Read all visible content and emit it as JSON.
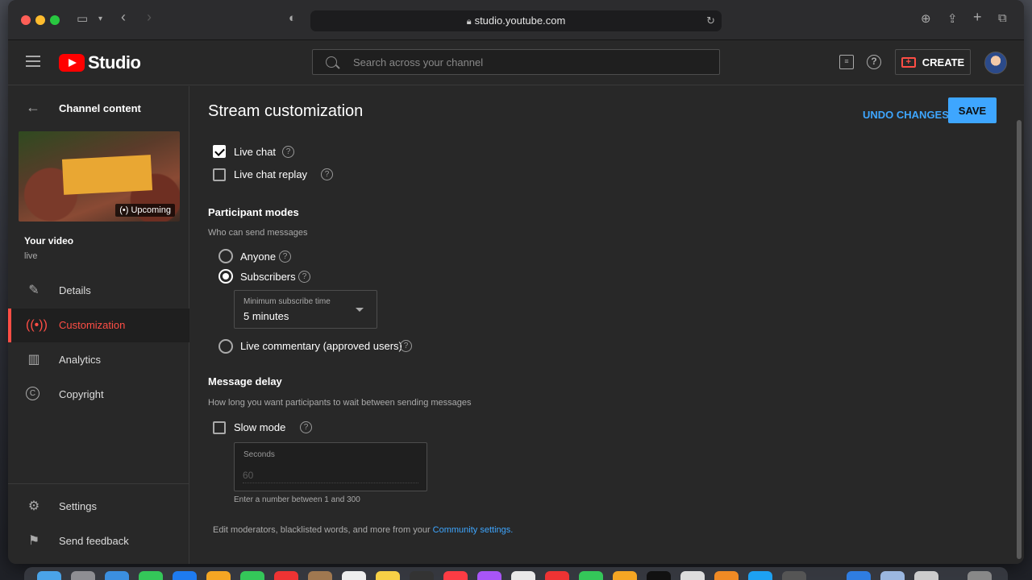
{
  "browser": {
    "url": "studio.youtube.com"
  },
  "header": {
    "logo_text": "Studio",
    "search_placeholder": "Search across your channel",
    "create_label": "CREATE"
  },
  "sidebar": {
    "back_label": "Channel content",
    "thumbnail_badge": "Upcoming",
    "video_title": "Your video",
    "video_subtitle": "live",
    "items": [
      {
        "label": "Details",
        "icon": "pencil-icon"
      },
      {
        "label": "Customization",
        "icon": "broadcast-icon",
        "active": true
      },
      {
        "label": "Analytics",
        "icon": "analytics-icon"
      },
      {
        "label": "Copyright",
        "icon": "copyright-icon"
      }
    ],
    "bottom_items": [
      {
        "label": "Settings",
        "icon": "gear-icon"
      },
      {
        "label": "Send feedback",
        "icon": "feedback-icon"
      }
    ]
  },
  "main": {
    "title": "Stream customization",
    "undo_label": "UNDO CHANGES",
    "save_label": "SAVE",
    "live_chat": {
      "label": "Live chat",
      "checked": true
    },
    "live_chat_replay": {
      "label": "Live chat replay",
      "checked": false
    },
    "participant_modes": {
      "title": "Participant modes",
      "description": "Who can send messages",
      "options": [
        {
          "label": "Anyone",
          "selected": false
        },
        {
          "label": "Subscribers",
          "selected": true
        },
        {
          "label": "Live commentary (approved users)",
          "selected": false
        }
      ],
      "min_subscribe_label": "Minimum subscribe time",
      "min_subscribe_value": "5 minutes"
    },
    "message_delay": {
      "title": "Message delay",
      "description": "How long you want participants to wait between sending messages",
      "slow_mode_label": "Slow mode",
      "slow_mode_checked": false,
      "seconds_label": "Seconds",
      "seconds_placeholder": "60",
      "hint": "Enter a number between 1 and 300"
    },
    "footer_text": "Edit moderators, blacklisted words, and more from your ",
    "footer_link": "Community settings."
  },
  "colors": {
    "accent": "#3ea6ff",
    "active": "#ff4e45",
    "brand": "#ff0000"
  }
}
